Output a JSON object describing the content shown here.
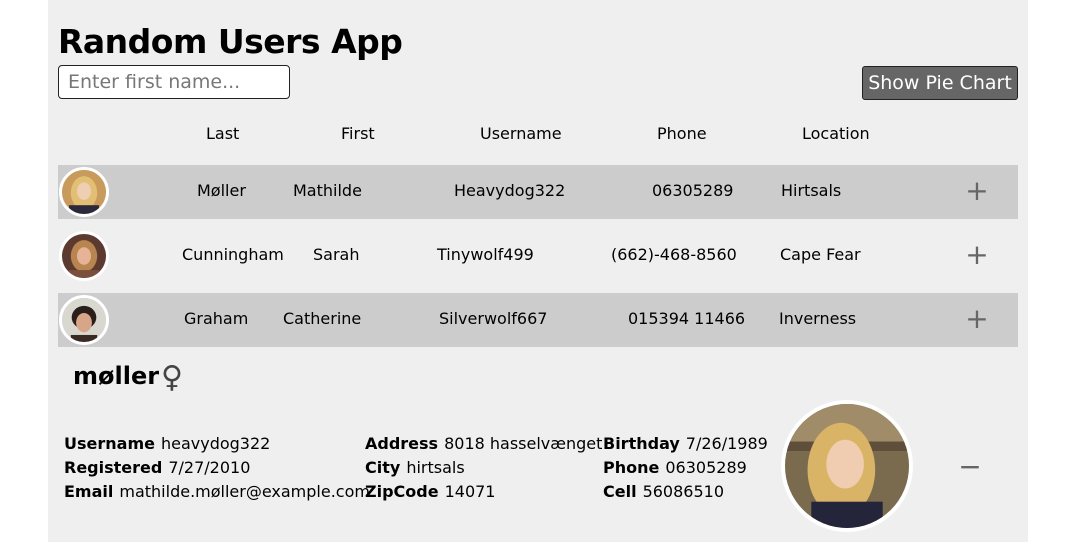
{
  "app": {
    "title": "Random Users App"
  },
  "search": {
    "placeholder": "Enter first name..."
  },
  "toolbar": {
    "pie_label": "Show Pie Chart"
  },
  "table": {
    "headers": [
      "Last",
      "First",
      "Username",
      "Phone",
      "Location"
    ],
    "rows": [
      {
        "last": "Møller",
        "first": "Mathilde",
        "username": "Heavydog322",
        "phone": "06305289",
        "location": "Hirtsals",
        "action": "+"
      },
      {
        "last": "Cunningham",
        "first": "Sarah",
        "username": "Tinywolf499",
        "phone": "(662)-468-8560",
        "location": "Cape Fear",
        "action": "+"
      },
      {
        "last": "Graham",
        "first": "Catherine",
        "username": "Silverwolf667",
        "phone": "015394 11466",
        "location": "Inverness",
        "action": "+"
      }
    ]
  },
  "detail": {
    "name": "møller",
    "gender_symbol": "♀",
    "collapse_symbol": "−",
    "fields": {
      "username": {
        "label": "Username",
        "value": "heavydog322"
      },
      "registered": {
        "label": "Registered",
        "value": "7/27/2010"
      },
      "email": {
        "label": "Email",
        "value": "mathilde.møller@example.com"
      },
      "address": {
        "label": "Address",
        "value": "8018 hasselvænget"
      },
      "city": {
        "label": "City",
        "value": "hirtsals"
      },
      "zipcode": {
        "label": "ZipCode",
        "value": "14071"
      },
      "birthday": {
        "label": "Birthday",
        "value": "7/26/1989"
      },
      "phone": {
        "label": "Phone",
        "value": "06305289"
      },
      "cell": {
        "label": "Cell",
        "value": "56086510"
      }
    }
  },
  "colors": {
    "panel": "#efefef",
    "row_shade": "#cccccc",
    "button_bg": "#666666",
    "icon_gray": "#666666"
  }
}
